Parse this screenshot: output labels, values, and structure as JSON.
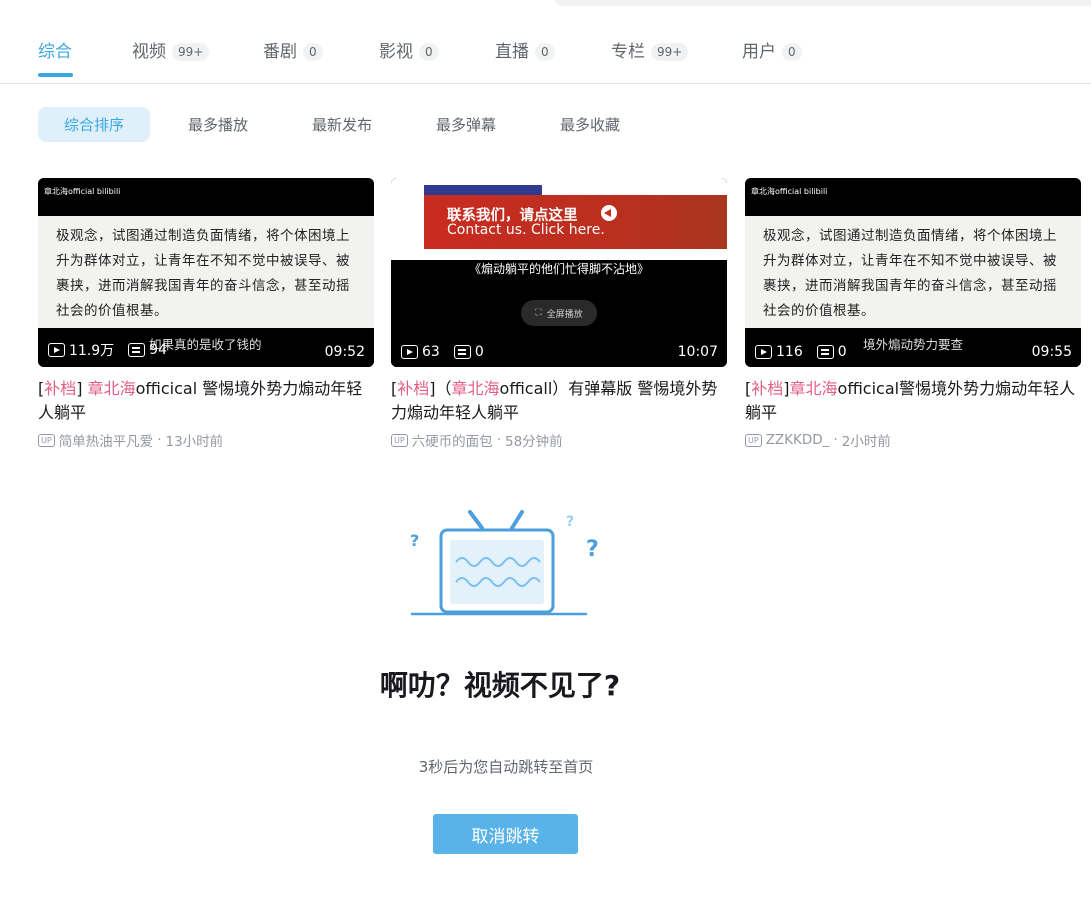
{
  "tabs": [
    {
      "label": "综合",
      "count": ""
    },
    {
      "label": "视频",
      "count": "99+"
    },
    {
      "label": "番剧",
      "count": "0"
    },
    {
      "label": "影视",
      "count": "0"
    },
    {
      "label": "直播",
      "count": "0"
    },
    {
      "label": "专栏",
      "count": "99+"
    },
    {
      "label": "用户",
      "count": "0"
    }
  ],
  "sort_options": [
    "综合排序",
    "最多播放",
    "最新发布",
    "最多弹幕",
    "最多收藏"
  ],
  "cards": [
    {
      "thumb_watermark": "章北海official bilibili",
      "thumb_text": "极观念，试图通过制造负面情绪，将个体困境上升为群体对立，让青年在不知不觉中被误导、被裹挟，进而消解我国青年的奋斗信念，甚至动摇社会的价值根基。",
      "thumb_caption": "如果真的是收了钱的",
      "plays": "11.9万",
      "danmaku": "94",
      "duration": "09:52",
      "title_prefix": "[",
      "title_tag": "补档",
      "title_mid": "] ",
      "title_hl": "章北海",
      "title_rest": "officical 警惕境外势力煽动年轻人躺平",
      "uploader": "简单热油平凡爱",
      "time": "13小时前"
    },
    {
      "thumb_red_cn": "联系我们，请点这里",
      "thumb_red_en": "Contact us. Click here.",
      "thumb_sub": "《煽动躺平的他们忙得脚不沾地》",
      "thumb_fs": "全屏播放",
      "plays": "63",
      "danmaku": "0",
      "duration": "10:07",
      "title_prefix": "[",
      "title_tag": "补档",
      "title_mid": "]（",
      "title_hl": "章北海",
      "title_rest": "officall）有弹幕版 警惕境外势力煽动年轻人躺平",
      "uploader": "六硬币的面包",
      "time": "58分钟前"
    },
    {
      "thumb_watermark": "章北海official bilibili",
      "thumb_text": "极观念，试图通过制造负面情绪，将个体困境上升为群体对立，让青年在不知不觉中被误导、被裹挟，进而消解我国青年的奋斗信念，甚至动摇社会的价值根基。",
      "thumb_caption": "境外煽动势力要查",
      "plays": "116",
      "danmaku": "0",
      "duration": "09:55",
      "title_prefix": "[",
      "title_tag": "补档",
      "title_mid": "]",
      "title_hl": "章北海",
      "title_rest": "officical警惕境外势力煽动年轻人躺平",
      "uploader": "ZZKKDD_",
      "time": "2小时前"
    }
  ],
  "up_badge": "UP",
  "meta_sep": "·",
  "empty": {
    "title": "啊叻？视频不见了?",
    "subtitle": "3秒后为您自动跳转至首页",
    "cancel_label": "取消跳转"
  },
  "colors": {
    "accent": "#3ca8e3",
    "highlight": "#e35e85",
    "button": "#59b3e8"
  }
}
